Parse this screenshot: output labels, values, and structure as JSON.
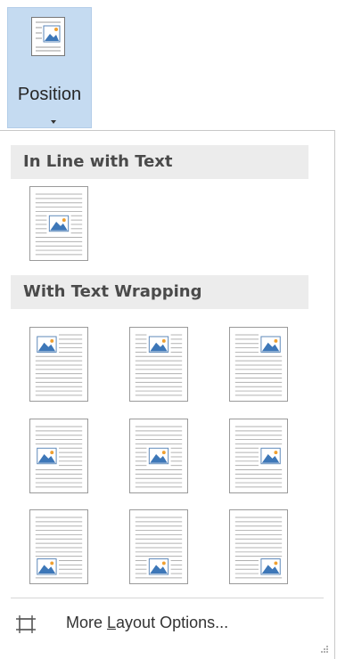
{
  "ribbon": {
    "position_button": {
      "label": "Position",
      "icon": "position-picture-icon"
    }
  },
  "panel": {
    "inline_section": {
      "title": "In Line with Text",
      "options": [
        {
          "icon": "inline-with-text-icon",
          "placement": "middle-center"
        }
      ]
    },
    "wrapping_section": {
      "title": "With Text Wrapping",
      "options": [
        {
          "icon": "top-left-icon",
          "placement": "top-left"
        },
        {
          "icon": "top-center-icon",
          "placement": "top-center"
        },
        {
          "icon": "top-right-icon",
          "placement": "top-right"
        },
        {
          "icon": "middle-left-icon",
          "placement": "middle-left"
        },
        {
          "icon": "middle-center-icon",
          "placement": "middle-center"
        },
        {
          "icon": "middle-right-icon",
          "placement": "middle-right"
        },
        {
          "icon": "bottom-left-icon",
          "placement": "bottom-left"
        },
        {
          "icon": "bottom-center-icon",
          "placement": "bottom-center"
        },
        {
          "icon": "bottom-right-icon",
          "placement": "bottom-right"
        }
      ]
    },
    "more_options": {
      "label_pre": "More ",
      "label_key": "L",
      "label_post": "ayout Options...",
      "icon": "layout-options-icon"
    }
  },
  "colors": {
    "button_highlight": "#c5dbf1",
    "picture_blue": "#3d77b8",
    "sun_orange": "#f0a030"
  }
}
